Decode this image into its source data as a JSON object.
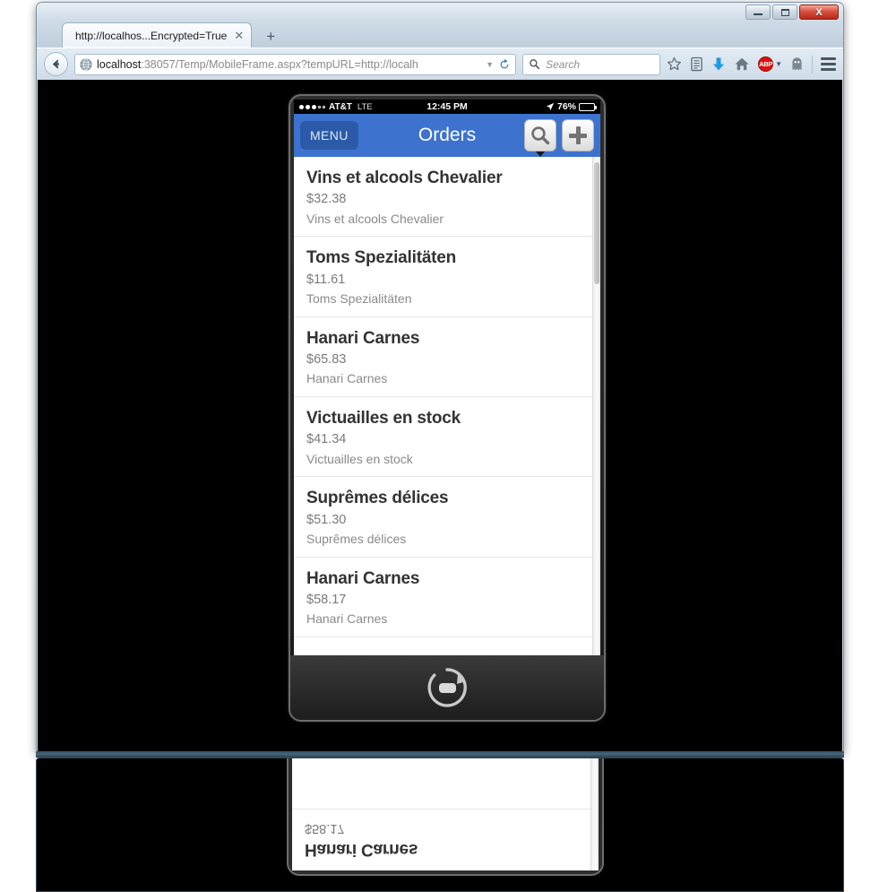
{
  "window": {
    "controls": {
      "minimize_label": "Minimize",
      "maximize_label": "Maximize",
      "close_label": "X"
    }
  },
  "browser": {
    "tab": {
      "title": "http://localhos...Encrypted=True",
      "close_label": "✕"
    },
    "new_tab_label": "+",
    "url": {
      "host": "localhost",
      "path": ":38057/Temp/MobileFrame.aspx?tempURL=http://localh",
      "full": "localhost:38057/Temp/MobileFrame.aspx?tempURL=http://localh"
    },
    "search": {
      "placeholder": "Search"
    },
    "toolbar_icons": [
      "back-icon",
      "globe-icon",
      "dropdown-icon",
      "reload-icon",
      "search-icon",
      "bookmark-star-icon",
      "reader-list-icon",
      "download-icon",
      "home-icon",
      "adblock-plus-icon",
      "ghostery-icon",
      "hamburger-menu-icon"
    ],
    "adblock_label": "ABP"
  },
  "device": {
    "status_bar": {
      "carrier": "AT&T",
      "network": "LTE",
      "time": "12:45 PM",
      "battery_percent": "76%",
      "battery_level": 76,
      "signal_filled": 3,
      "signal_empty": 2,
      "location_icon": "location-arrow-icon"
    },
    "app_nav": {
      "menu_label": "MENU",
      "title": "Orders",
      "search_icon": "search-icon",
      "add_icon": "plus-icon"
    },
    "footer": {
      "rotate_icon": "rotate-device-icon"
    }
  },
  "orders": [
    {
      "name": "Vins et alcools Chevalier",
      "price": "$32.38",
      "subtitle": "Vins et alcools Chevalier"
    },
    {
      "name": "Toms Spezialitäten",
      "price": "$11.61",
      "subtitle": "Toms Spezialitäten"
    },
    {
      "name": "Hanari Carnes",
      "price": "$65.83",
      "subtitle": "Hanari Carnes"
    },
    {
      "name": "Victuailles en stock",
      "price": "$41.34",
      "subtitle": "Victuailles en stock"
    },
    {
      "name": "Suprêmes délices",
      "price": "$51.30",
      "subtitle": "Suprêmes délices"
    },
    {
      "name": "Hanari Carnes",
      "price": "$58.17",
      "subtitle": "Hanari Carnes"
    }
  ],
  "reflection": {
    "orders": [
      {
        "name": "Hanari Carnes",
        "price": "$58.17"
      }
    ]
  },
  "colors": {
    "nav_blue": "#3d73ce",
    "menu_blue": "#2b5ba8",
    "title_text": "#333333",
    "muted_text": "#8a8a8a",
    "abp_red": "#d8140f",
    "download_blue": "#1f9ae0",
    "close_red": "#d9503e"
  }
}
